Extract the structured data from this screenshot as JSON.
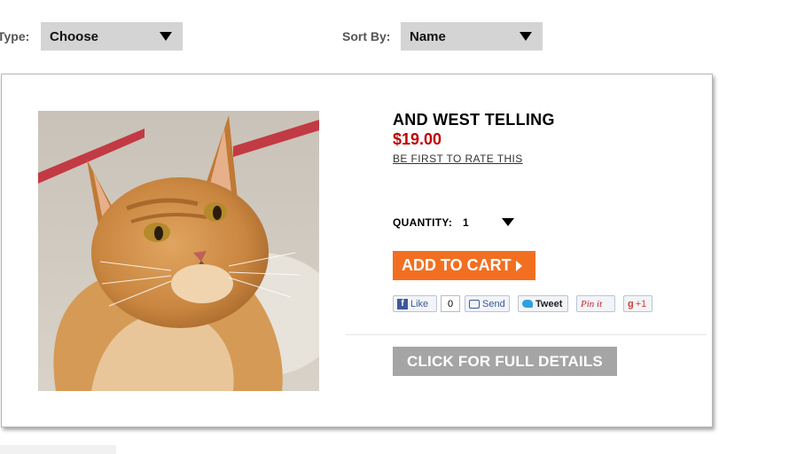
{
  "filters": {
    "type_label": "Type:",
    "type_value": "Choose",
    "sort_label": "Sort By:",
    "sort_value": "Name"
  },
  "product": {
    "title": "AND WEST TELLING",
    "price": "$19.00",
    "rate_link": "BE FIRST TO RATE THIS",
    "quantity_label": "QUANTITY:",
    "quantity_value": "1",
    "add_to_cart": "ADD TO CART",
    "full_details": "CLICK FOR FULL DETAILS"
  },
  "social": {
    "like_icon": "f",
    "like": "Like",
    "like_count": "0",
    "send": "Send",
    "tweet": "Tweet",
    "pinit": "Pin it",
    "gplus_icon": "g",
    "gplus": "+1"
  },
  "colors": {
    "accent_orange": "#f26f21",
    "price_red": "#c00000",
    "details_gray": "#a5a5a5",
    "select_gray": "#d4d4d4"
  }
}
